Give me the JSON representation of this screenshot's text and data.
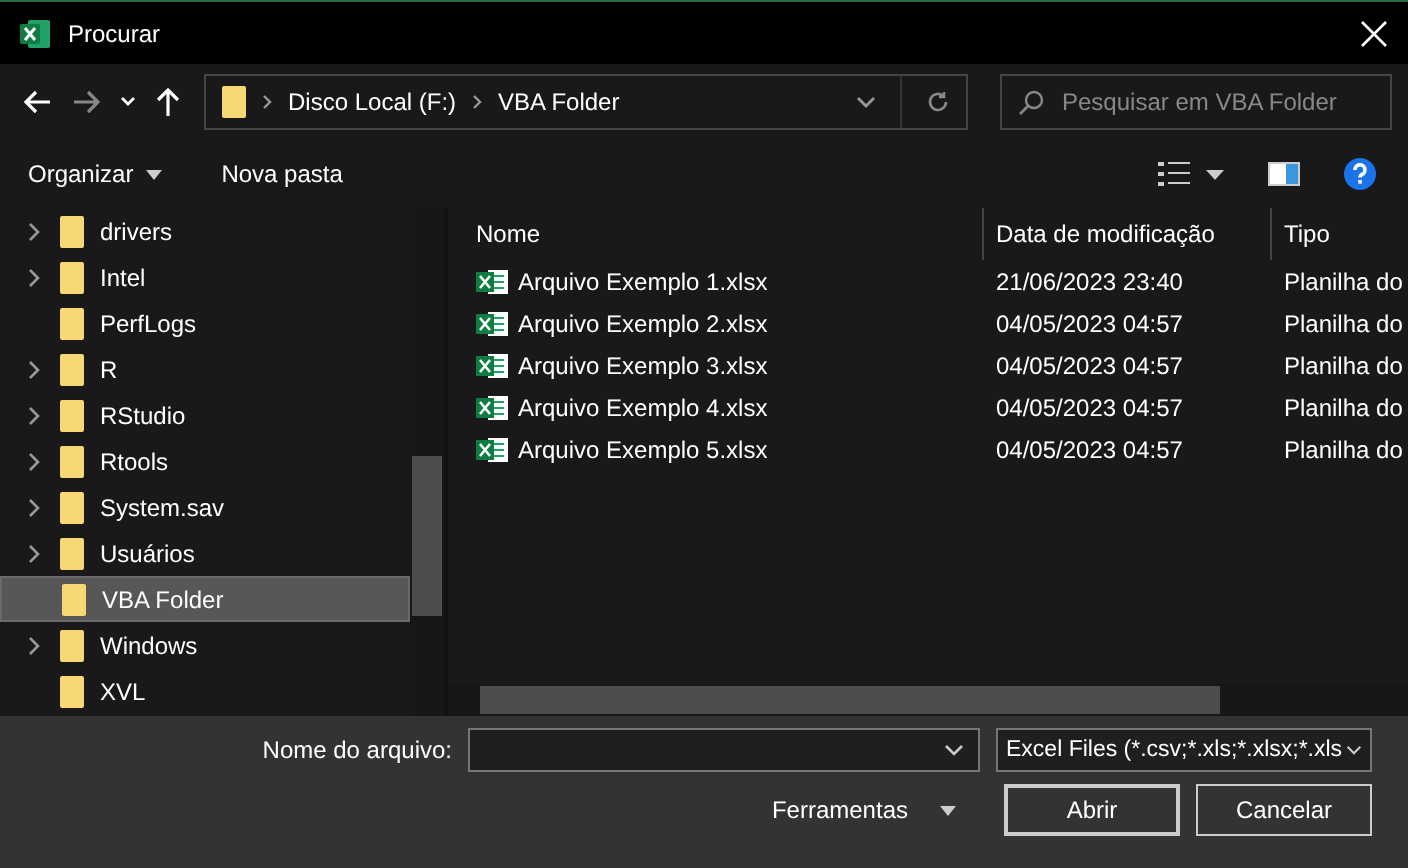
{
  "window": {
    "title": "Procurar"
  },
  "address": {
    "segments": [
      "Disco Local (F:)",
      "VBA Folder"
    ]
  },
  "search": {
    "placeholder": "Pesquisar em VBA Folder"
  },
  "toolbar": {
    "organize": "Organizar",
    "new_folder": "Nova pasta"
  },
  "sidebar": {
    "items": [
      {
        "label": "drivers",
        "expandable": true,
        "selected": false
      },
      {
        "label": "Intel",
        "expandable": true,
        "selected": false
      },
      {
        "label": "PerfLogs",
        "expandable": false,
        "selected": false
      },
      {
        "label": "R",
        "expandable": true,
        "selected": false
      },
      {
        "label": "RStudio",
        "expandable": true,
        "selected": false
      },
      {
        "label": "Rtools",
        "expandable": true,
        "selected": false
      },
      {
        "label": "System.sav",
        "expandable": true,
        "selected": false
      },
      {
        "label": "Usuários",
        "expandable": true,
        "selected": false
      },
      {
        "label": "VBA Folder",
        "expandable": false,
        "selected": true
      },
      {
        "label": "Windows",
        "expandable": true,
        "selected": false
      },
      {
        "label": "XVL",
        "expandable": false,
        "selected": false
      }
    ]
  },
  "table": {
    "columns": [
      "Nome",
      "Data de modificação",
      "Tipo"
    ],
    "rows": [
      [
        "Arquivo Exemplo 1.xlsx",
        "21/06/2023 23:40",
        "Planilha do"
      ],
      [
        "Arquivo Exemplo 2.xlsx",
        "04/05/2023 04:57",
        "Planilha do"
      ],
      [
        "Arquivo Exemplo 3.xlsx",
        "04/05/2023 04:57",
        "Planilha do"
      ],
      [
        "Arquivo Exemplo 4.xlsx",
        "04/05/2023 04:57",
        "Planilha do"
      ],
      [
        "Arquivo Exemplo 5.xlsx",
        "04/05/2023 04:57",
        "Planilha do"
      ]
    ]
  },
  "footer": {
    "filename_label": "Nome do arquivo:",
    "filter": "Excel Files (*.csv;*.xls;*.xlsx;*.xls",
    "tools": "Ferramentas",
    "open": "Abrir",
    "cancel": "Cancelar"
  }
}
